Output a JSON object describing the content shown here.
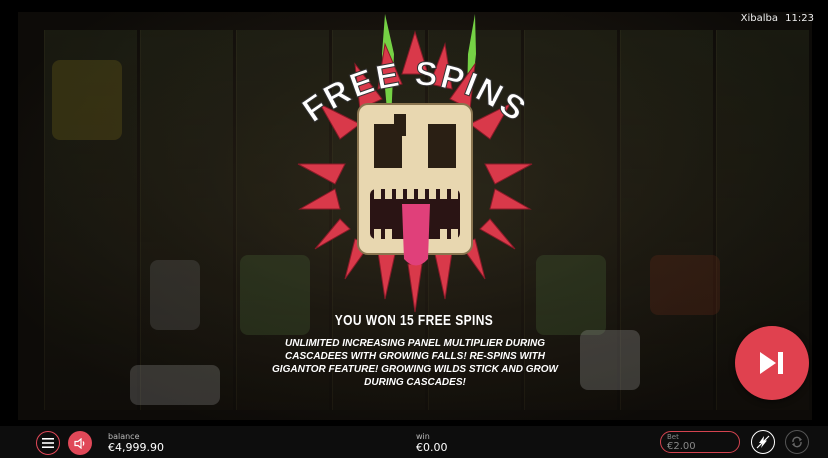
{
  "header": {
    "game_title": "Xibalba",
    "clock": "11:23"
  },
  "popup": {
    "banner": "FREE SPINS",
    "title": "YOU WON 15 FREE SPINS",
    "description": "UNLIMITED INCREASING PANEL MULTIPLIER DURING CASCADEES WITH GROWING FALLS! RE-SPINS WITH GIGANTOR FEATURE! GROWING WILDS STICK AND GROW DURING CASCADES!"
  },
  "controls": {
    "skip_icon": "skip-forward-icon",
    "menu_icon": "hamburger-menu-icon",
    "sound_icon": "speaker-icon",
    "turbo_icon": "lightning-icon",
    "autoplay_icon": "autoplay-icon"
  },
  "status": {
    "balance_label": "balance",
    "balance_value": "€4,999.90",
    "win_label": "win",
    "win_value": "€0.00",
    "bet_label": "Bet",
    "bet_value": "€2.00"
  },
  "colors": {
    "accent": "#e0414f",
    "crystal": "#d9394a",
    "mask": "#e8d7b0",
    "tongue": "#e0407a",
    "feather_green": "#7ee64a"
  }
}
